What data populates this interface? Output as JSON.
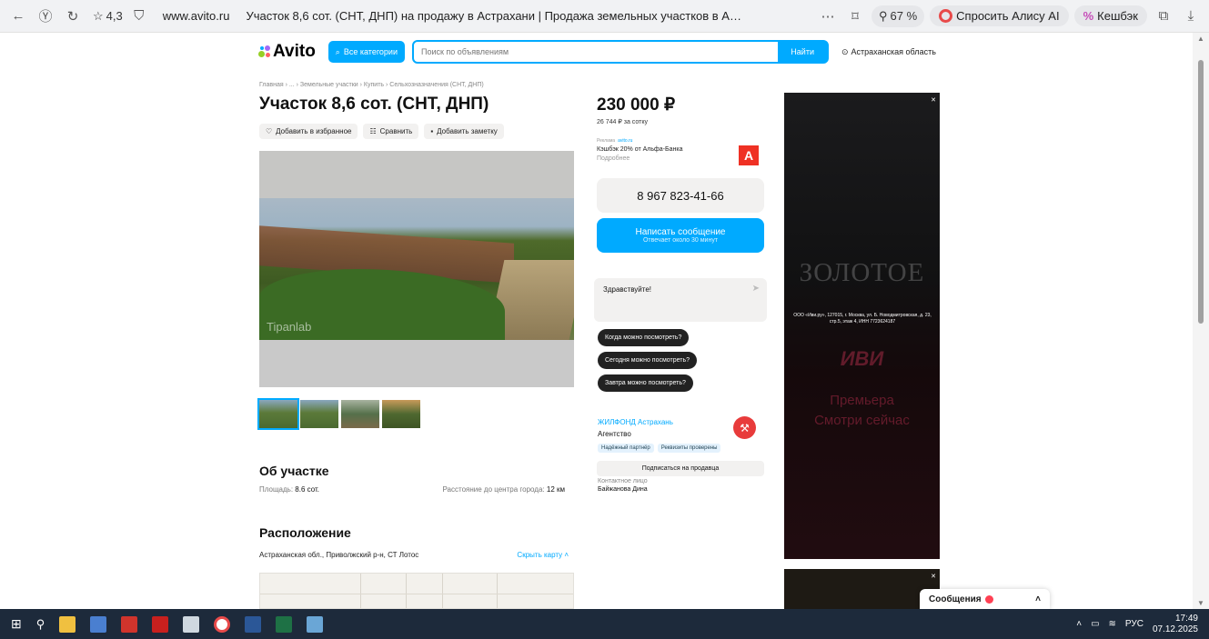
{
  "browser": {
    "rating": "4,3",
    "url": "www.avito.ru",
    "title": "Участок 8,6 сот. (СНТ, ДНП) на продажу в Астрахани | Продажа земельных участков в Ас...",
    "zoom": "67 %",
    "alice": "Спросить Алису AI",
    "cashback": "Кешбэк"
  },
  "header": {
    "logo": "Avito",
    "categories": "Все категории",
    "search_placeholder": "Поиск по объявлениям",
    "search_button": "Найти",
    "region": "Астраханская область"
  },
  "listing": {
    "breadcrumb": "Главная › ... › Земельные участки › Купить › Сельхозназначения (СНТ, ДНП)",
    "title": "Участок 8,6 сот. (СНТ, ДНП)",
    "actions": {
      "favorite": "Добавить в избранное",
      "compare": "Сравнить",
      "note": "Добавить заметку"
    },
    "photo_watermark": "Tipanlab",
    "about_heading": "Об участке",
    "area_label": "Площадь:",
    "area_value": "8.6 сот.",
    "distance_label": "Расстояние до центра города:",
    "distance_value": "12 км",
    "location_heading": "Расположение",
    "address": "Астраханская обл., Приволжский р-н, СТ Лотос",
    "hide_map": "Скрыть карту ˄"
  },
  "sidebar": {
    "price": "230 000 ₽",
    "per_sotka": "26 744 ₽ за сотку",
    "ad_label": "Реклама",
    "ad_source": "avito.ru",
    "ad_text": "Кэшбэк 20% от Альфа-Банка",
    "ad_more": "Подробнее",
    "alfa_logo": "А",
    "phone": "8 967 823-41-66",
    "write_button": "Написать сообщение",
    "write_sub": "Отвечает около 30 минут",
    "chat_greeting": "Здравствуйте!",
    "quick_questions": [
      "Когда можно посмотреть?",
      "Сегодня можно посмотреть?",
      "Завтра можно посмотреть?"
    ],
    "seller_name": "ЖИЛФОНД Астрахань",
    "seller_type": "Агентство",
    "badges": [
      "Надёжный партнёр",
      "Реквизиты проверены"
    ],
    "subscribe": "Подписаться на продавца",
    "contact_label": "Контактное лицо",
    "contact_name": "Байжанова Дина"
  },
  "banner": {
    "headline": "ЗОЛОТОЕ",
    "legal": "ООО «Иви.ру», 127015, г. Москва, ул. Б. Новодмитровская, д. 23, стр.5, этаж 4, ИНН 7723624187",
    "brand": "ИВИ",
    "premiere": "Премьера",
    "watch": "Смотри сейчас"
  },
  "messages_popup": {
    "label": "Сообщения"
  },
  "taskbar": {
    "lang": "РУС",
    "time": "17:49",
    "date": "07.12.2025"
  }
}
